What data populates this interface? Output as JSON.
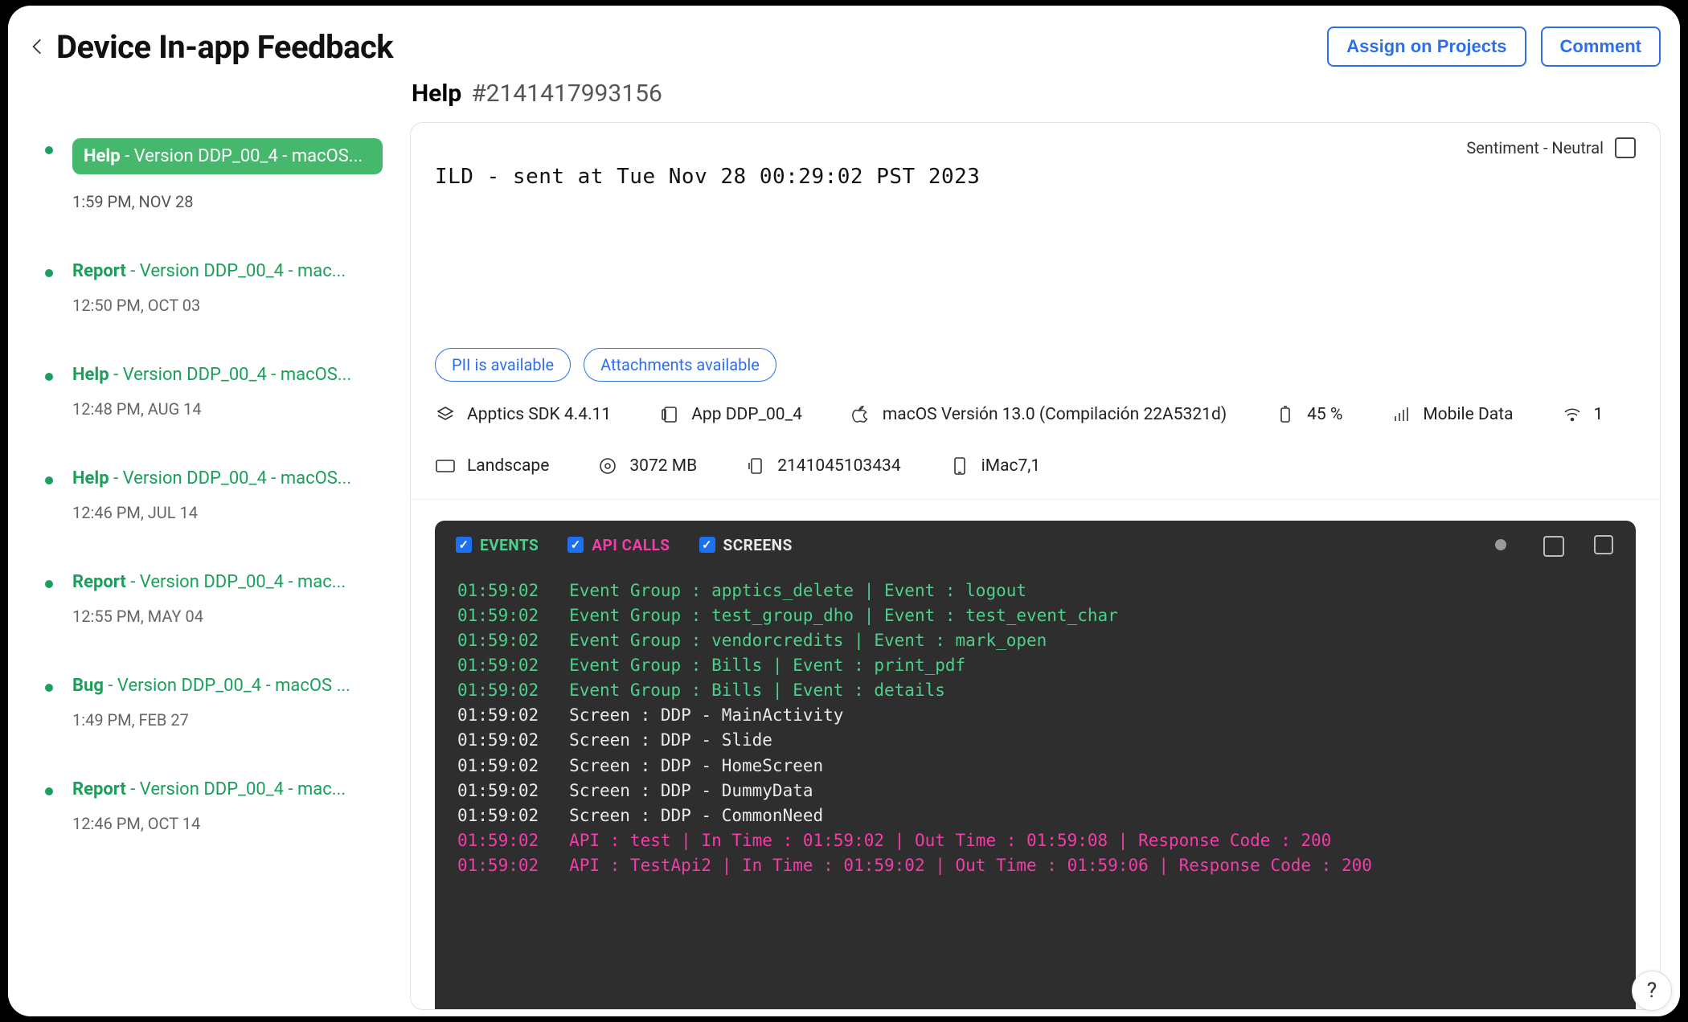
{
  "header": {
    "title": "Device In-app Feedback",
    "assign_label": "Assign on Projects",
    "comment_label": "Comment"
  },
  "sub_header": {
    "label": "Help",
    "id": "#2141417993156"
  },
  "sidebar": {
    "items": [
      {
        "type": "Help",
        "rest": " - Version DDP_00_4 - macOS...",
        "time": "1:59 PM, NOV 28",
        "active": true
      },
      {
        "type": "Report",
        "rest": " - Version DDP_00_4 - mac...",
        "time": "12:50 PM, OCT 03",
        "active": false
      },
      {
        "type": "Help",
        "rest": " - Version DDP_00_4 - macOS...",
        "time": "12:48 PM, AUG 14",
        "active": false
      },
      {
        "type": "Help",
        "rest": " - Version DDP_00_4 - macOS...",
        "time": "12:46 PM, JUL 14",
        "active": false
      },
      {
        "type": "Report",
        "rest": " - Version DDP_00_4 - mac...",
        "time": "12:55 PM, MAY 04",
        "active": false
      },
      {
        "type": "Bug",
        "rest": " - Version DDP_00_4 - macOS ...",
        "time": "1:49 PM, FEB 27",
        "active": false
      },
      {
        "type": "Report",
        "rest": " - Version DDP_00_4 - mac...",
        "time": "12:46 PM, OCT 14",
        "active": false
      }
    ]
  },
  "detail": {
    "sentiment": "Sentiment - Neutral",
    "message": "ILD - sent at Tue Nov 28 00:29:02 PST 2023",
    "chips": {
      "pii": "PII is available",
      "attachments": "Attachments available"
    },
    "meta": {
      "sdk": "Apptics SDK 4.4.11",
      "app": "App DDP_00_4",
      "os": "macOS Versión 13.0 (Compilación 22A5321d)",
      "battery": "45 %",
      "network": "Mobile Data",
      "wifi": "1",
      "orientation": "Landscape",
      "memory": "3072 MB",
      "device_id": "2141045103434",
      "device_model": "iMac7,1"
    },
    "filters": {
      "events": "EVENTS",
      "api": "API CALLS",
      "screens": "SCREENS"
    },
    "logs": [
      {
        "t": "01:59:02",
        "kind": "event",
        "text": "Event Group : apptics_delete | Event : logout"
      },
      {
        "t": "01:59:02",
        "kind": "event",
        "text": "Event Group : test_group_dho | Event : test_event_char"
      },
      {
        "t": "01:59:02",
        "kind": "event",
        "text": "Event Group : vendorcredits | Event : mark_open"
      },
      {
        "t": "01:59:02",
        "kind": "event",
        "text": "Event Group : Bills | Event : print_pdf"
      },
      {
        "t": "01:59:02",
        "kind": "event",
        "text": "Event Group : Bills | Event : details"
      },
      {
        "t": "01:59:02",
        "kind": "screen",
        "text": "Screen : DDP - MainActivity"
      },
      {
        "t": "01:59:02",
        "kind": "screen",
        "text": "Screen : DDP - Slide"
      },
      {
        "t": "01:59:02",
        "kind": "screen",
        "text": "Screen : DDP - HomeScreen"
      },
      {
        "t": "01:59:02",
        "kind": "screen",
        "text": "Screen : DDP - DummyData"
      },
      {
        "t": "01:59:02",
        "kind": "screen",
        "text": "Screen : DDP - CommonNeed"
      },
      {
        "t": "01:59:02",
        "kind": "api",
        "text": "API : test | In Time : 01:59:02 | Out Time : 01:59:08 | Response Code : 200"
      },
      {
        "t": "01:59:02",
        "kind": "api",
        "text": "API : TestApi2 | In Time : 01:59:02 | Out Time : 01:59:06 | Response Code : 200"
      }
    ]
  },
  "help_fab": "?"
}
